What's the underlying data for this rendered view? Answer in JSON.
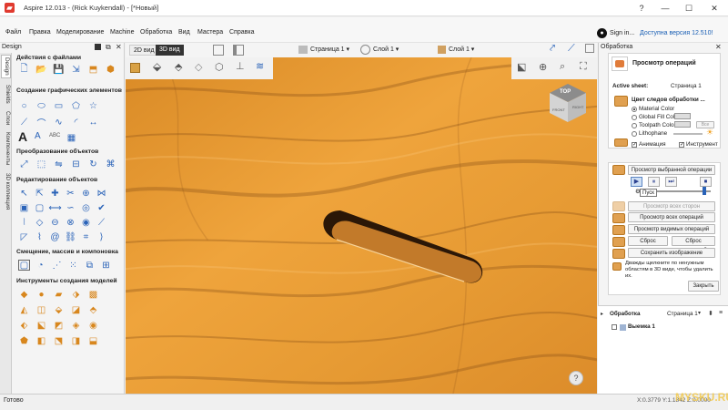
{
  "window": {
    "title": "Aspire 12.013 - (Rick Kuykendall) - [*Новый]",
    "logo_char": "▰"
  },
  "window_buttons": {
    "help": "?",
    "minimize": "—",
    "maximize": "☐",
    "close": "✕"
  },
  "menu": {
    "items": [
      "Файл",
      "Правка",
      "Моделирование",
      "Machine",
      "Обработка",
      "Вид",
      "Мастера",
      "Справка"
    ],
    "signin": "Sign in...",
    "avatar": "●",
    "update": "Доступна версия 12.510!"
  },
  "left_panel": {
    "title": "Design",
    "vtabs": [
      "Design",
      "Shields",
      "Слои",
      "Компоненты",
      "3D коллекция"
    ],
    "sections": {
      "files": "Действия с файлами",
      "vector_create": "Создание графических элементов",
      "vector_transform": "Преобразование объектов",
      "vector_edit": "Редактирование объектов",
      "offset": "Смещение, массив и компоновка",
      "modeling": "Инструменты создания моделей"
    },
    "text_icons": {
      "big_a": "A",
      "small_a": "A",
      "abc": "ABC"
    }
  },
  "view_tabs": {
    "tab2d": "2D вид",
    "tab3d": "3D вид",
    "page_label": "Страница 1 ▾",
    "layer_label": "Слой 1 ▾",
    "layer2_label": "Слой 1 ▾"
  },
  "viewport": {
    "cube_top": "TOP",
    "cube_front": "FRONT",
    "cube_right": "RIGHT",
    "help": "?"
  },
  "right_panel": {
    "header": "Обработка",
    "ops_title": "Просмотр операций",
    "active_sheet_label": "Active sheet:",
    "active_sheet_value": "Страница 1",
    "color_title": "Цвет следов обработки ...",
    "color_options": [
      "Material Color",
      "Global Fill Color",
      "Toolpath Color",
      "Lithophane"
    ],
    "toolpath_color_btn": "Все",
    "animation": "Анимация",
    "tool": "Инструмент",
    "preview_selected": "Просмотр выбранной операции",
    "play_buttons": [
      "▶",
      "⏸",
      "⏭",
      "⏹"
    ],
    "tooltip": "Пуск",
    "preview_all_sides": "Просмотр всех сторон",
    "preview_all_ops": "Просмотр всех операций",
    "preview_visible": "Просмотр видимых операций",
    "reset": "Сброс",
    "reset_last": "Сброс последней",
    "save_image": "Сохранить изображение",
    "hint": "Дважды щелкните по ненужным областям в 3D виде, чтобы удалить их.",
    "close": "Закрыть",
    "toolpaths_header": "Обработка",
    "toolpaths_page": "Страница 1",
    "toolpath_item": "Выемка 1"
  },
  "status": {
    "ready": "Готово",
    "coords": "X:0.3779 Y:1.1842 Z:0.0000",
    "watermark": "MYSKU.RU"
  }
}
